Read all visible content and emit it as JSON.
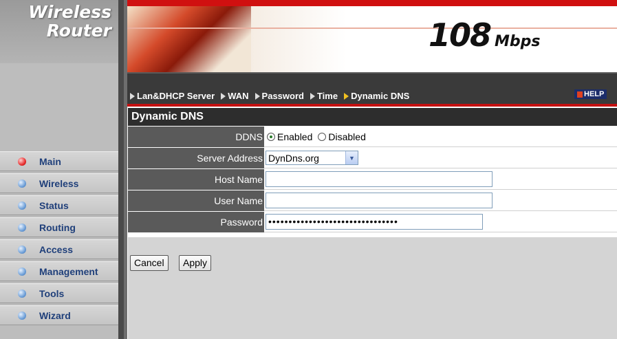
{
  "sidebar": {
    "logo_line1": "Wireless",
    "logo_line2": "Router",
    "items": [
      {
        "label": "Main",
        "active": true
      },
      {
        "label": "Wireless",
        "active": false
      },
      {
        "label": "Status",
        "active": false
      },
      {
        "label": "Routing",
        "active": false
      },
      {
        "label": "Access",
        "active": false
      },
      {
        "label": "Management",
        "active": false
      },
      {
        "label": "Tools",
        "active": false
      },
      {
        "label": "Wizard",
        "active": false
      }
    ]
  },
  "banner": {
    "speed_number": "108",
    "speed_unit": "Mbps"
  },
  "nav": {
    "items": [
      {
        "label": "Lan&DHCP Server"
      },
      {
        "label": "WAN"
      },
      {
        "label": "Password"
      },
      {
        "label": "Time"
      },
      {
        "label": "Dynamic DNS",
        "active": true
      }
    ],
    "help_label": "HELP"
  },
  "section": {
    "title": "Dynamic DNS"
  },
  "form": {
    "ddns_label": "DDNS",
    "enabled_label": "Enabled",
    "disabled_label": "Disabled",
    "ddns_selected": "Enabled",
    "server_address_label": "Server Address",
    "server_address_value": "DynDns.org",
    "host_name_label": "Host Name",
    "host_name_value": "",
    "user_name_label": "User Name",
    "user_name_value": "",
    "password_label": "Password",
    "password_value": "••••••••••••••••••••••••••••••••"
  },
  "buttons": {
    "cancel_label": "Cancel",
    "apply_label": "Apply"
  },
  "colors": {
    "brand_red": "#d01010",
    "nav_bg": "#3a3a3a",
    "menu_text": "#1f3f7a"
  }
}
